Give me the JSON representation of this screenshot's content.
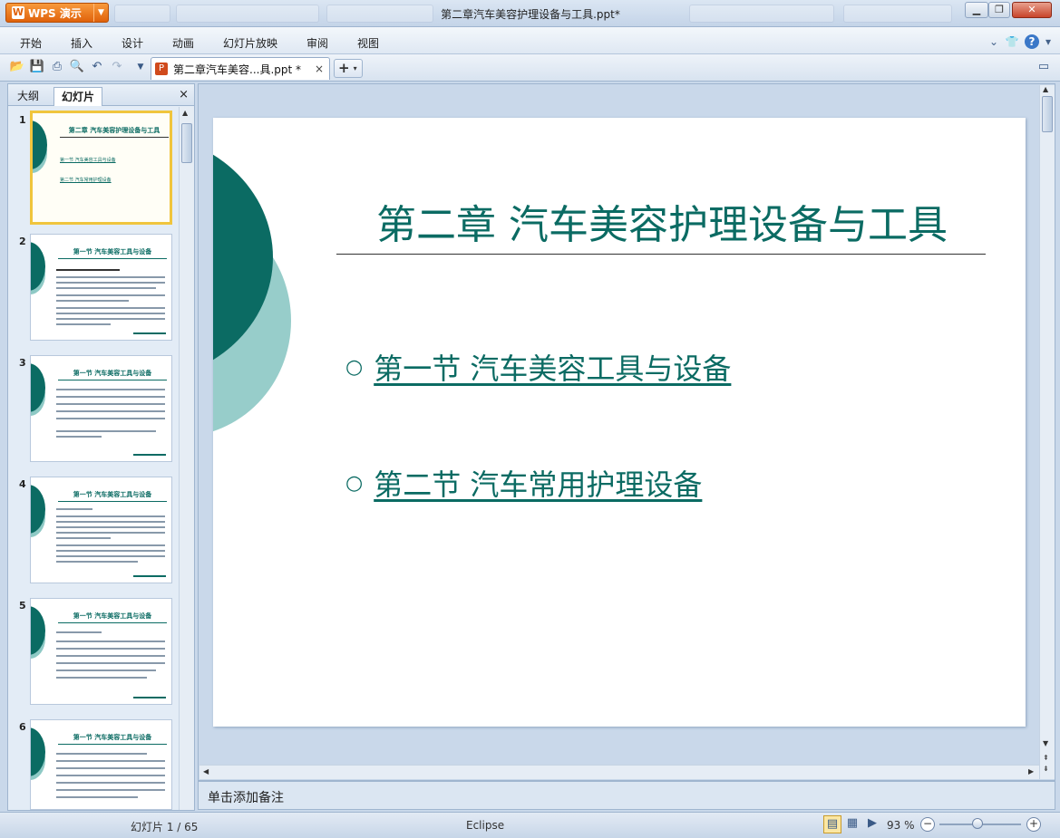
{
  "app": {
    "brand_label": "WPS 演示",
    "window_title": "第二章汽车美容护理设备与工具.ppt*"
  },
  "menu": [
    "开始",
    "插入",
    "设计",
    "动画",
    "幻灯片放映",
    "审阅",
    "视图"
  ],
  "document_tab": {
    "name": "第二章汽车美容...具.ppt *",
    "close_label": "×"
  },
  "left_panel": {
    "tabs": [
      "大纲",
      "幻灯片"
    ],
    "active_tab": "幻灯片",
    "close_label": "×",
    "thumbnails": [
      {
        "num": "1",
        "title": "第二章 汽车美容护理设备与工具",
        "selected": true
      },
      {
        "num": "2",
        "title": "第一节 汽车美容工具与设备"
      },
      {
        "num": "3",
        "title": "第一节 汽车美容工具与设备"
      },
      {
        "num": "4",
        "title": "第一节 汽车美容工具与设备"
      },
      {
        "num": "5",
        "title": "第一节 汽车美容工具与设备"
      },
      {
        "num": "6",
        "title": "第一节 汽车美容工具与设备"
      }
    ]
  },
  "slide": {
    "title": "第二章 汽车美容护理设备与工具",
    "links": [
      {
        "bullet": "○",
        "text": "第一节 汽车美容工具与设备"
      },
      {
        "bullet": "○",
        "text": "第二节 汽车常用护理设备"
      }
    ],
    "colors": {
      "accent": "#0b6b63",
      "accent_light": "#97cdca"
    }
  },
  "notes": {
    "placeholder": "单击添加备注"
  },
  "status": {
    "slide_counter": "幻灯片 1 / 65",
    "theme": "Eclipse",
    "zoom": "93 %",
    "zoom_minus": "−",
    "zoom_plus": "+"
  },
  "icons": [
    "open-icon",
    "save-icon",
    "print-icon",
    "print-preview-icon",
    "undo-icon",
    "redo-icon",
    "help-icon",
    "skin-icon"
  ]
}
